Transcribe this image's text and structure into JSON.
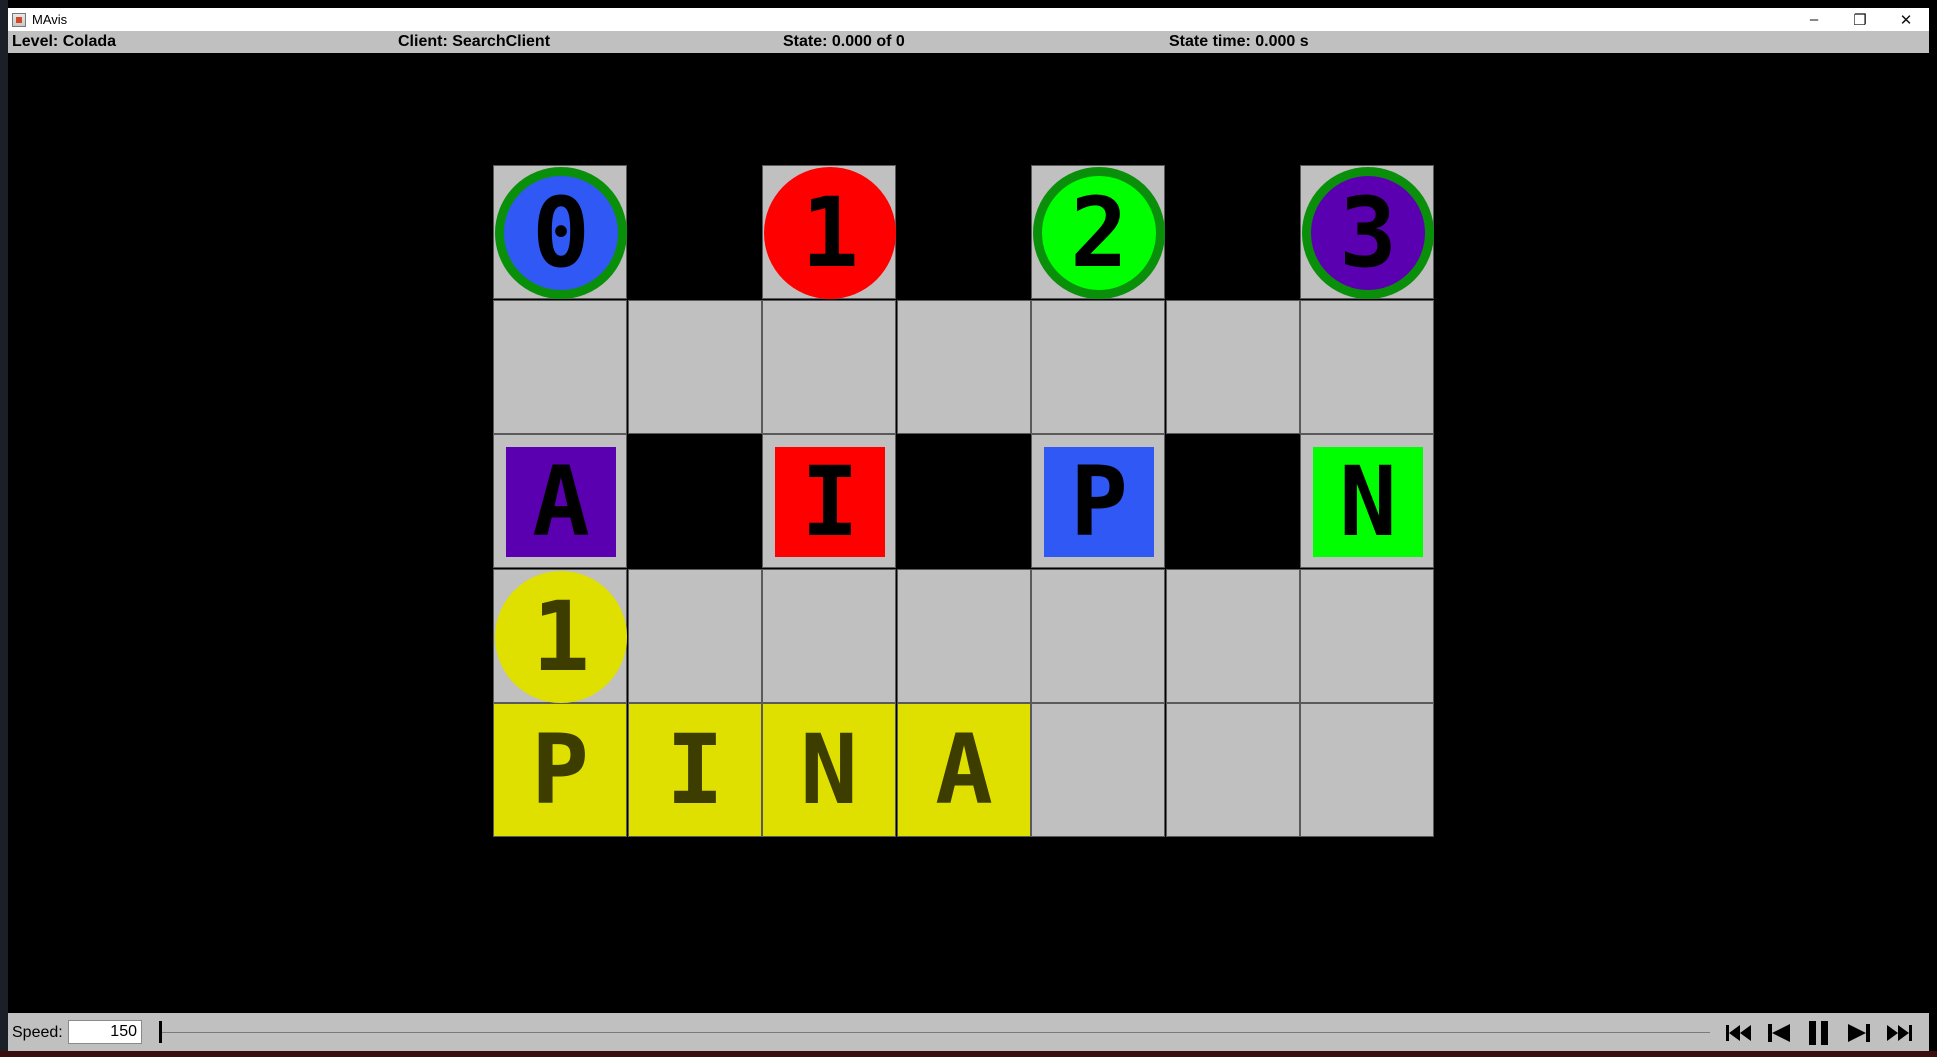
{
  "window": {
    "title": "MAvis",
    "app_icon": "java-cup-icon",
    "controls": {
      "minimize": "–",
      "restore": "❐",
      "close": "✕"
    }
  },
  "status": {
    "level": "Level: Colada",
    "client": "Client: SearchClient",
    "state": "State: 0.000 of 0",
    "state_time": "State time: 0.000 s"
  },
  "board": {
    "rows": 5,
    "cols": 7,
    "wall_cells": [
      [
        0,
        1
      ],
      [
        0,
        3
      ],
      [
        0,
        5
      ],
      [
        2,
        1
      ],
      [
        2,
        3
      ],
      [
        2,
        5
      ]
    ],
    "agents": [
      {
        "row": 0,
        "col": 0,
        "label": "0",
        "color": "#2f58f5",
        "goal_ring": true
      },
      {
        "row": 0,
        "col": 2,
        "label": "1",
        "color": "#ff0000",
        "goal_ring": false
      },
      {
        "row": 0,
        "col": 4,
        "label": "2",
        "color": "#00ff00",
        "goal_ring": true
      },
      {
        "row": 0,
        "col": 6,
        "label": "3",
        "color": "#5b00b0",
        "goal_ring": true
      }
    ],
    "boxes": [
      {
        "row": 2,
        "col": 0,
        "label": "A",
        "color": "#5b00b0"
      },
      {
        "row": 2,
        "col": 2,
        "label": "I",
        "color": "#ff0000"
      },
      {
        "row": 2,
        "col": 4,
        "label": "P",
        "color": "#2f58f5"
      },
      {
        "row": 2,
        "col": 6,
        "label": "N",
        "color": "#00ff00"
      }
    ],
    "goal_agents": [
      {
        "row": 3,
        "col": 0,
        "label": "1"
      }
    ],
    "goal_boxes": [
      {
        "row": 4,
        "col": 0,
        "label": "P"
      },
      {
        "row": 4,
        "col": 1,
        "label": "I"
      },
      {
        "row": 4,
        "col": 2,
        "label": "N"
      },
      {
        "row": 4,
        "col": 3,
        "label": "A"
      }
    ],
    "ring_color": "#0a8f0a",
    "goal_color": "#dfdf00"
  },
  "controls": {
    "speed_label": "Speed:",
    "speed_value": "150",
    "slider_position": 0,
    "buttons": [
      "skip-to-start-icon",
      "step-back-icon",
      "pause-icon",
      "step-forward-icon",
      "skip-to-end-icon"
    ]
  }
}
